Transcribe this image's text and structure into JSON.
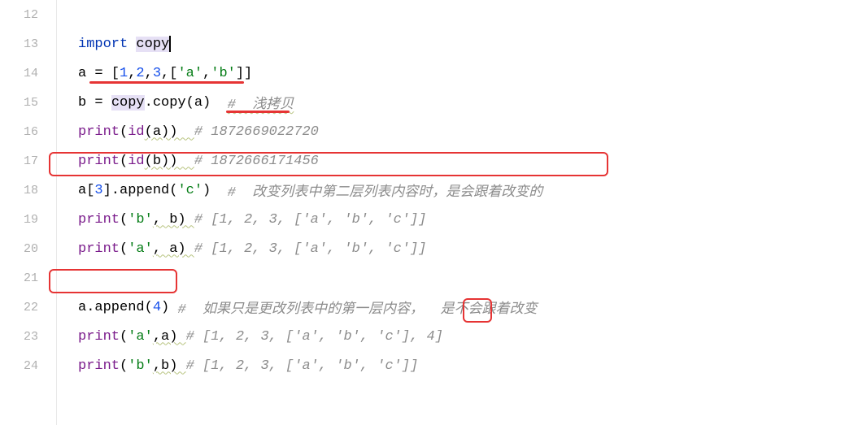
{
  "gutter": [
    "12",
    "13",
    "14",
    "15",
    "16",
    "17",
    "18",
    "19",
    "20",
    "21",
    "22",
    "23",
    "24"
  ],
  "lines": {
    "l13": {
      "kw": "import",
      "sp": " ",
      "mod": "copy"
    },
    "l14": {
      "lhs": "a = [",
      "n1": "1",
      "c": ",",
      "n2": "2",
      "n3": "3",
      "s1": "'a'",
      "s2": "'b'",
      "br": "[",
      "brc": "]]"
    },
    "l15": {
      "lhs": "b = ",
      "obj": "copy",
      "dot": ".",
      "fn": "copy",
      "paren": "(a)  ",
      "cmt": "#  浅拷贝"
    },
    "l16": {
      "fn": "print",
      "p": "(",
      "bi": "id",
      "arg": "(a))  ",
      "cmt": "# 1872669022720"
    },
    "l17": {
      "fn": "print",
      "p": "(",
      "bi": "id",
      "arg": "(b))  ",
      "cmt": "# 1872666171456"
    },
    "l18": {
      "pre": "a[",
      "idx": "3",
      "mid": "].append(",
      "s": "'c'",
      "post": ")  ",
      "cmt": "#  改变列表中第二层列表内容时，是会跟着改变的"
    },
    "l19": {
      "fn": "print",
      "p": "(",
      "s": "'b'",
      "rest": ", b) ",
      "cmt": "# [1, 2, 3, ['a', 'b', 'c']]"
    },
    "l20": {
      "fn": "print",
      "p": "(",
      "s": "'a'",
      "rest": ", a) ",
      "cmt": "# [1, 2, 3, ['a', 'b', 'c']]"
    },
    "l22": {
      "pre": "a.append(",
      "n": "4",
      "post": ") ",
      "cmt": "#  如果只是更改列表中的第一层内容，  是不会跟着改变"
    },
    "l23": {
      "fn": "print",
      "p": "(",
      "s": "'a'",
      "rest": ",a) ",
      "cmt": "# [1, 2, 3, ['a', 'b', 'c'], 4]"
    },
    "l24": {
      "fn": "print",
      "p": "(",
      "s": "'b'",
      "rest": ",b) ",
      "cmt": "# [1, 2, 3, ['a', 'b', 'c']]"
    }
  }
}
